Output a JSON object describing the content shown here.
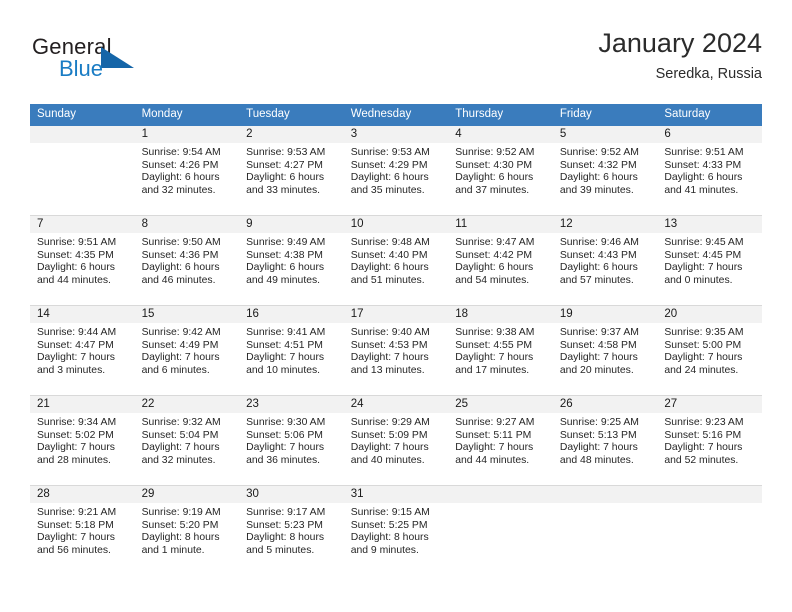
{
  "brand": {
    "word_one": "General",
    "word_two": "Blue",
    "triangle_icon": "brand-triangle-icon",
    "accent_color": "#1a7cc4",
    "triangle_color": "#1565a8"
  },
  "header": {
    "title": "January 2024",
    "location": "Seredka, Russia"
  },
  "calendar": {
    "header_bg": "#3a7cbd",
    "daynum_band_bg": "#f2f2f2",
    "weekdays": [
      "Sunday",
      "Monday",
      "Tuesday",
      "Wednesday",
      "Thursday",
      "Friday",
      "Saturday"
    ],
    "weeks": [
      [
        {
          "day": "",
          "lines": []
        },
        {
          "day": "1",
          "lines": [
            "Sunrise: 9:54 AM",
            "Sunset: 4:26 PM",
            "Daylight: 6 hours",
            "and 32 minutes."
          ]
        },
        {
          "day": "2",
          "lines": [
            "Sunrise: 9:53 AM",
            "Sunset: 4:27 PM",
            "Daylight: 6 hours",
            "and 33 minutes."
          ]
        },
        {
          "day": "3",
          "lines": [
            "Sunrise: 9:53 AM",
            "Sunset: 4:29 PM",
            "Daylight: 6 hours",
            "and 35 minutes."
          ]
        },
        {
          "day": "4",
          "lines": [
            "Sunrise: 9:52 AM",
            "Sunset: 4:30 PM",
            "Daylight: 6 hours",
            "and 37 minutes."
          ]
        },
        {
          "day": "5",
          "lines": [
            "Sunrise: 9:52 AM",
            "Sunset: 4:32 PM",
            "Daylight: 6 hours",
            "and 39 minutes."
          ]
        },
        {
          "day": "6",
          "lines": [
            "Sunrise: 9:51 AM",
            "Sunset: 4:33 PM",
            "Daylight: 6 hours",
            "and 41 minutes."
          ]
        }
      ],
      [
        {
          "day": "7",
          "lines": [
            "Sunrise: 9:51 AM",
            "Sunset: 4:35 PM",
            "Daylight: 6 hours",
            "and 44 minutes."
          ]
        },
        {
          "day": "8",
          "lines": [
            "Sunrise: 9:50 AM",
            "Sunset: 4:36 PM",
            "Daylight: 6 hours",
            "and 46 minutes."
          ]
        },
        {
          "day": "9",
          "lines": [
            "Sunrise: 9:49 AM",
            "Sunset: 4:38 PM",
            "Daylight: 6 hours",
            "and 49 minutes."
          ]
        },
        {
          "day": "10",
          "lines": [
            "Sunrise: 9:48 AM",
            "Sunset: 4:40 PM",
            "Daylight: 6 hours",
            "and 51 minutes."
          ]
        },
        {
          "day": "11",
          "lines": [
            "Sunrise: 9:47 AM",
            "Sunset: 4:42 PM",
            "Daylight: 6 hours",
            "and 54 minutes."
          ]
        },
        {
          "day": "12",
          "lines": [
            "Sunrise: 9:46 AM",
            "Sunset: 4:43 PM",
            "Daylight: 6 hours",
            "and 57 minutes."
          ]
        },
        {
          "day": "13",
          "lines": [
            "Sunrise: 9:45 AM",
            "Sunset: 4:45 PM",
            "Daylight: 7 hours",
            "and 0 minutes."
          ]
        }
      ],
      [
        {
          "day": "14",
          "lines": [
            "Sunrise: 9:44 AM",
            "Sunset: 4:47 PM",
            "Daylight: 7 hours",
            "and 3 minutes."
          ]
        },
        {
          "day": "15",
          "lines": [
            "Sunrise: 9:42 AM",
            "Sunset: 4:49 PM",
            "Daylight: 7 hours",
            "and 6 minutes."
          ]
        },
        {
          "day": "16",
          "lines": [
            "Sunrise: 9:41 AM",
            "Sunset: 4:51 PM",
            "Daylight: 7 hours",
            "and 10 minutes."
          ]
        },
        {
          "day": "17",
          "lines": [
            "Sunrise: 9:40 AM",
            "Sunset: 4:53 PM",
            "Daylight: 7 hours",
            "and 13 minutes."
          ]
        },
        {
          "day": "18",
          "lines": [
            "Sunrise: 9:38 AM",
            "Sunset: 4:55 PM",
            "Daylight: 7 hours",
            "and 17 minutes."
          ]
        },
        {
          "day": "19",
          "lines": [
            "Sunrise: 9:37 AM",
            "Sunset: 4:58 PM",
            "Daylight: 7 hours",
            "and 20 minutes."
          ]
        },
        {
          "day": "20",
          "lines": [
            "Sunrise: 9:35 AM",
            "Sunset: 5:00 PM",
            "Daylight: 7 hours",
            "and 24 minutes."
          ]
        }
      ],
      [
        {
          "day": "21",
          "lines": [
            "Sunrise: 9:34 AM",
            "Sunset: 5:02 PM",
            "Daylight: 7 hours",
            "and 28 minutes."
          ]
        },
        {
          "day": "22",
          "lines": [
            "Sunrise: 9:32 AM",
            "Sunset: 5:04 PM",
            "Daylight: 7 hours",
            "and 32 minutes."
          ]
        },
        {
          "day": "23",
          "lines": [
            "Sunrise: 9:30 AM",
            "Sunset: 5:06 PM",
            "Daylight: 7 hours",
            "and 36 minutes."
          ]
        },
        {
          "day": "24",
          "lines": [
            "Sunrise: 9:29 AM",
            "Sunset: 5:09 PM",
            "Daylight: 7 hours",
            "and 40 minutes."
          ]
        },
        {
          "day": "25",
          "lines": [
            "Sunrise: 9:27 AM",
            "Sunset: 5:11 PM",
            "Daylight: 7 hours",
            "and 44 minutes."
          ]
        },
        {
          "day": "26",
          "lines": [
            "Sunrise: 9:25 AM",
            "Sunset: 5:13 PM",
            "Daylight: 7 hours",
            "and 48 minutes."
          ]
        },
        {
          "day": "27",
          "lines": [
            "Sunrise: 9:23 AM",
            "Sunset: 5:16 PM",
            "Daylight: 7 hours",
            "and 52 minutes."
          ]
        }
      ],
      [
        {
          "day": "28",
          "lines": [
            "Sunrise: 9:21 AM",
            "Sunset: 5:18 PM",
            "Daylight: 7 hours",
            "and 56 minutes."
          ]
        },
        {
          "day": "29",
          "lines": [
            "Sunrise: 9:19 AM",
            "Sunset: 5:20 PM",
            "Daylight: 8 hours",
            "and 1 minute."
          ]
        },
        {
          "day": "30",
          "lines": [
            "Sunrise: 9:17 AM",
            "Sunset: 5:23 PM",
            "Daylight: 8 hours",
            "and 5 minutes."
          ]
        },
        {
          "day": "31",
          "lines": [
            "Sunrise: 9:15 AM",
            "Sunset: 5:25 PM",
            "Daylight: 8 hours",
            "and 9 minutes."
          ]
        },
        {
          "day": "",
          "lines": []
        },
        {
          "day": "",
          "lines": []
        },
        {
          "day": "",
          "lines": []
        }
      ]
    ]
  }
}
